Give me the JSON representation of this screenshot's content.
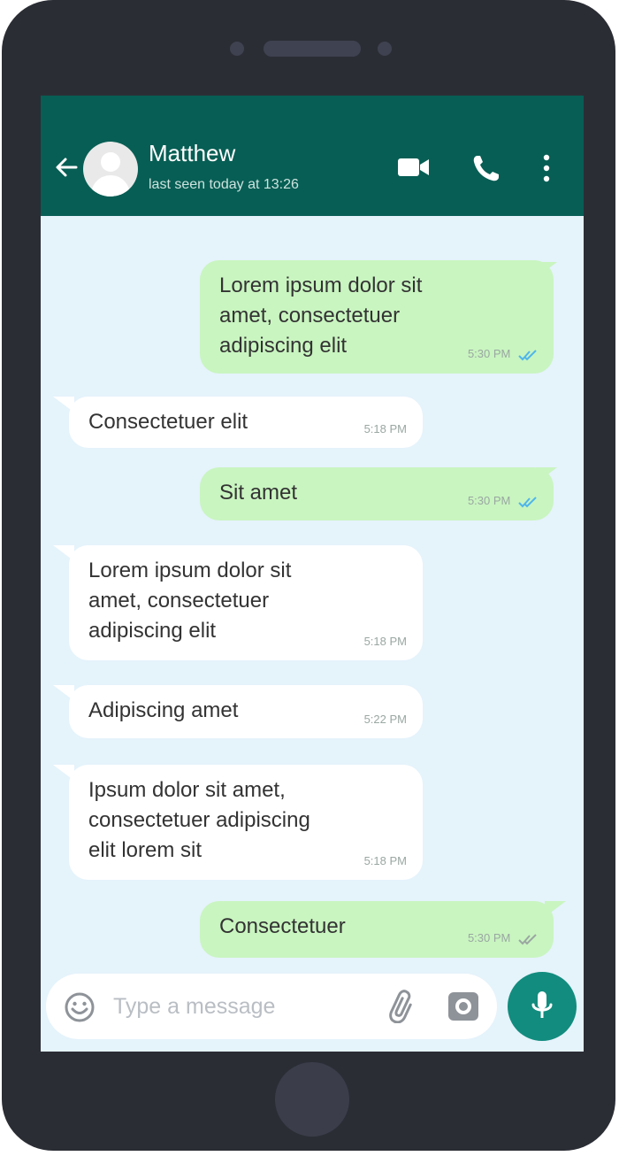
{
  "header": {
    "contact_name": "Matthew",
    "last_seen": "last seen today at 13:26"
  },
  "messages": [
    {
      "direction": "out",
      "text": "Lorem ipsum dolor sit\namet, consectetuer\nadipiscing elit",
      "time": "5:30 PM",
      "ticks": "read"
    },
    {
      "direction": "in",
      "text": "Consectetuer elit",
      "time": "5:18 PM"
    },
    {
      "direction": "out",
      "text": "Sit amet",
      "time": "5:30 PM",
      "ticks": "read"
    },
    {
      "direction": "in",
      "text": "Lorem ipsum dolor sit\namet, consectetuer\nadipiscing elit",
      "time": "5:18 PM"
    },
    {
      "direction": "in",
      "text": "Adipiscing amet",
      "time": "5:22 PM"
    },
    {
      "direction": "in",
      "text": "Ipsum dolor sit amet,\nconsectetuer adipiscing\nelit lorem sit",
      "time": "5:18 PM"
    },
    {
      "direction": "out",
      "text": "Consectetuer",
      "time": "5:30 PM",
      "ticks": "delivered"
    }
  ],
  "composer": {
    "placeholder": "Type a message"
  },
  "icons": [
    "back-arrow-icon",
    "avatar",
    "video-call-icon",
    "voice-call-icon",
    "more-options-icon",
    "emoji-icon",
    "attach-icon",
    "camera-icon",
    "mic-icon"
  ],
  "colors": {
    "header": "#075e54",
    "chat_background": "#e5f3fb",
    "outgoing_bubble": "#c9f5c0",
    "incoming_bubble": "#ffffff",
    "accent": "#128c7e",
    "read_ticks": "#4fb6ec",
    "phone_body": "#2b2d35"
  }
}
